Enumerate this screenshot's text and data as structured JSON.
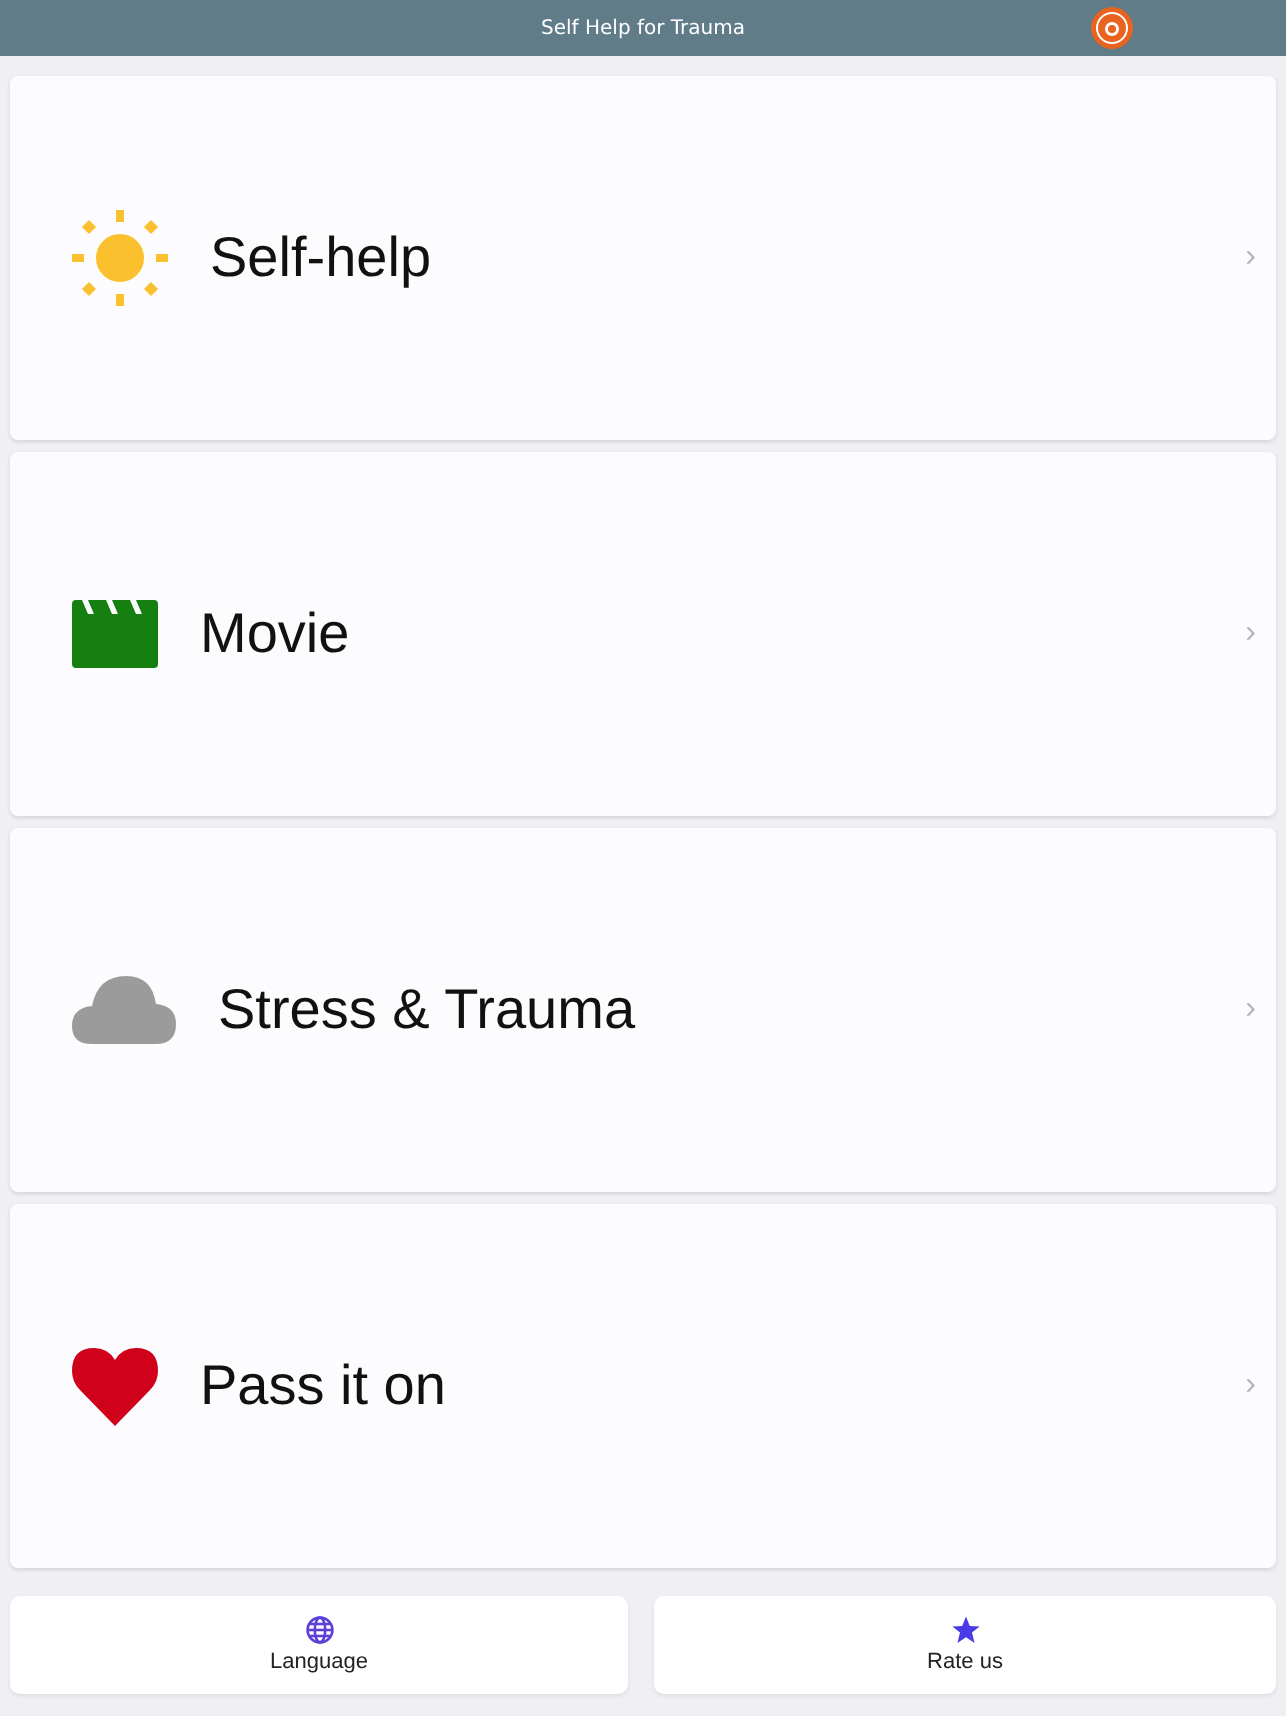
{
  "header": {
    "title": "Self Help for Trauma"
  },
  "menu": [
    {
      "kind": "sun",
      "label": "Self-help",
      "chevron": "›"
    },
    {
      "kind": "clapper",
      "label": "Movie",
      "chevron": "›"
    },
    {
      "kind": "cloud",
      "label": "Stress & Trauma",
      "chevron": "›"
    },
    {
      "kind": "heart",
      "label": "Pass it on",
      "chevron": "›"
    }
  ],
  "actions": [
    {
      "kind": "globe",
      "label": "Language"
    },
    {
      "kind": "star",
      "label": "Rate us"
    }
  ]
}
